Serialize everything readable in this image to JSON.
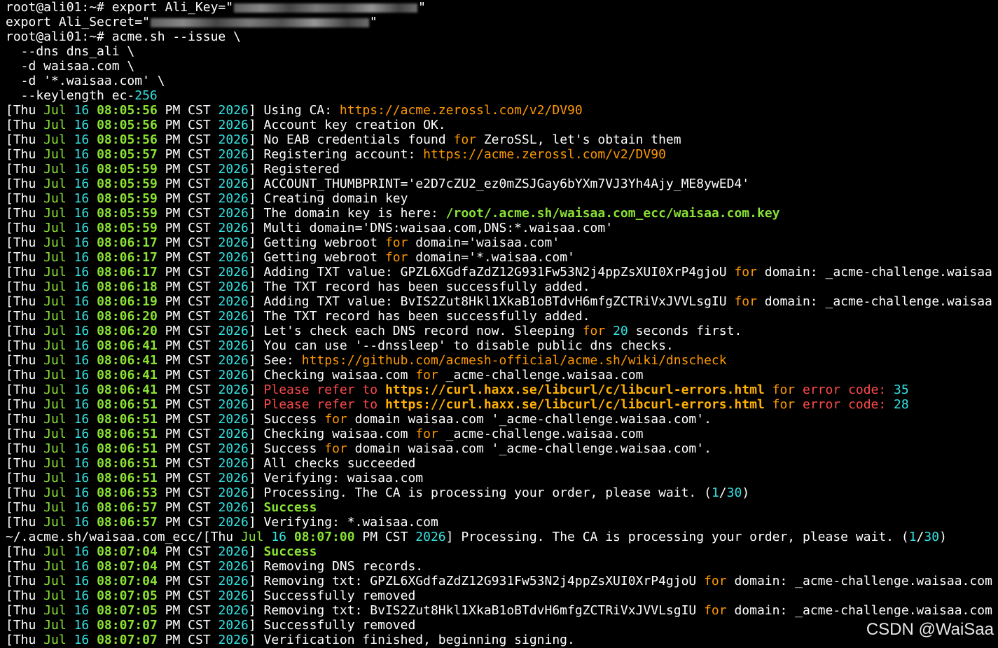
{
  "terminal": {
    "cmd1_prompt": "root@ali01:~# ",
    "cmd1_text": "export Ali_Key=\"",
    "cmd1_end": "\"",
    "cmd2_text": "export Ali_Secret=\"",
    "cmd2_end": "\"",
    "cmd3_prompt": "root@ali01:~# ",
    "cmd3_text": "acme.sh --issue \\",
    "cmd3_l2": "  --dns dns_ali \\",
    "cmd3_l3": "  -d waisaa.com \\",
    "cmd3_l4": "  -d '*.waisaa.com' \\",
    "cmd3_l5a": "  --keylength ec-",
    "cmd3_l5b": "256",
    "log": [
      {
        "time": "08:05:56",
        "parts": [
          {
            "t": "Using CA: "
          },
          {
            "t": "https://acme.zerossl.com/v2/DV90",
            "c": "o"
          }
        ]
      },
      {
        "time": "08:05:56",
        "parts": [
          {
            "t": "Account key creation OK."
          }
        ]
      },
      {
        "time": "08:05:56",
        "parts": [
          {
            "t": "No EAB credentials found "
          },
          {
            "t": "for",
            "c": "o"
          },
          {
            "t": " ZeroSSL, let's obtain them"
          }
        ]
      },
      {
        "time": "08:05:57",
        "parts": [
          {
            "t": "Registering account: "
          },
          {
            "t": "https://acme.zerossl.com/v2/DV90",
            "c": "o"
          }
        ]
      },
      {
        "time": "08:05:59",
        "parts": [
          {
            "t": "Registered"
          }
        ]
      },
      {
        "time": "08:05:59",
        "parts": [
          {
            "t": "ACCOUNT_THUMBPRINT='e2D7cZU2_ez0mZSJGay6bYXm7VJ3Yh4Ajy_ME8ywED4'"
          }
        ]
      },
      {
        "time": "08:05:59",
        "parts": [
          {
            "t": "Creating domain key"
          }
        ]
      },
      {
        "time": "08:05:59",
        "parts": [
          {
            "t": "The domain key is here: "
          },
          {
            "t": "/root/.acme.sh/waisaa.com_ecc/waisaa.com.key",
            "c": "gb"
          }
        ]
      },
      {
        "time": "08:05:59",
        "parts": [
          {
            "t": "Multi domain='DNS:waisaa.com,DNS:*.waisaa.com'"
          }
        ]
      },
      {
        "time": "08:06:17",
        "parts": [
          {
            "t": "Getting webroot "
          },
          {
            "t": "for",
            "c": "o"
          },
          {
            "t": " domain='waisaa.com'"
          }
        ]
      },
      {
        "time": "08:06:17",
        "parts": [
          {
            "t": "Getting webroot "
          },
          {
            "t": "for",
            "c": "o"
          },
          {
            "t": " domain='*.waisaa.com'"
          }
        ]
      },
      {
        "time": "08:06:17",
        "parts": [
          {
            "t": "Adding TXT value: GPZL6XGdfaZdZ12G931Fw53N2j4ppZsXUI0XrP4gjoU "
          },
          {
            "t": "for",
            "c": "o"
          },
          {
            "t": " domain: _acme-challenge.waisaa.com"
          }
        ]
      },
      {
        "time": "08:06:18",
        "parts": [
          {
            "t": "The TXT record has been successfully added."
          }
        ]
      },
      {
        "time": "08:06:19",
        "parts": [
          {
            "t": "Adding TXT value: BvIS2Zut8Hkl1XkaB1oBTdvH6mfgZCTRiVxJVVLsgIU "
          },
          {
            "t": "for",
            "c": "o"
          },
          {
            "t": " domain: _acme-challenge.waisaa.com"
          }
        ]
      },
      {
        "time": "08:06:20",
        "parts": [
          {
            "t": "The TXT record has been successfully added."
          }
        ]
      },
      {
        "time": "08:06:20",
        "parts": [
          {
            "t": "Let's check each DNS record now. Sleeping "
          },
          {
            "t": "for",
            "c": "o"
          },
          {
            "t": " "
          },
          {
            "t": "20",
            "c": "c"
          },
          {
            "t": " seconds first."
          }
        ]
      },
      {
        "time": "08:06:41",
        "parts": [
          {
            "t": "You can use '--dnssleep' to disable public dns checks."
          }
        ]
      },
      {
        "time": "08:06:41",
        "parts": [
          {
            "t": "See: "
          },
          {
            "t": "https://github.com/acmesh-official/acme.sh/wiki/dnscheck",
            "c": "o"
          }
        ]
      },
      {
        "time": "08:06:41",
        "parts": [
          {
            "t": "Checking waisaa.com "
          },
          {
            "t": "for",
            "c": "o"
          },
          {
            "t": " _acme-challenge.waisaa.com"
          }
        ]
      },
      {
        "time": "08:06:41",
        "parts": [
          {
            "t": "Please refer to ",
            "c": "r"
          },
          {
            "t": "https://curl.haxx.se/libcurl/c/libcurl-errors.html",
            "c": "ob"
          },
          {
            "t": " for",
            "c": "o"
          },
          {
            "t": " error code: ",
            "c": "r"
          },
          {
            "t": "35",
            "c": "c"
          }
        ]
      },
      {
        "time": "08:06:51",
        "parts": [
          {
            "t": "Please refer to ",
            "c": "r"
          },
          {
            "t": "https://curl.haxx.se/libcurl/c/libcurl-errors.html",
            "c": "ob"
          },
          {
            "t": " for",
            "c": "o"
          },
          {
            "t": " error code: ",
            "c": "r"
          },
          {
            "t": "28",
            "c": "c"
          }
        ]
      },
      {
        "time": "08:06:51",
        "parts": [
          {
            "t": "Success "
          },
          {
            "t": "for",
            "c": "o"
          },
          {
            "t": " domain waisaa.com '_acme-challenge.waisaa.com'."
          }
        ]
      },
      {
        "time": "08:06:51",
        "parts": [
          {
            "t": "Checking waisaa.com "
          },
          {
            "t": "for",
            "c": "o"
          },
          {
            "t": " _acme-challenge.waisaa.com"
          }
        ]
      },
      {
        "time": "08:06:51",
        "parts": [
          {
            "t": "Success "
          },
          {
            "t": "for",
            "c": "o"
          },
          {
            "t": " domain waisaa.com '_acme-challenge.waisaa.com'."
          }
        ]
      },
      {
        "time": "08:06:51",
        "parts": [
          {
            "t": "All checks succeeded"
          }
        ]
      },
      {
        "time": "08:06:51",
        "parts": [
          {
            "t": "Verifying: waisaa.com"
          }
        ]
      },
      {
        "time": "08:06:53",
        "parts": [
          {
            "t": "Processing. The CA is processing your order, please wait. ("
          },
          {
            "t": "1",
            "c": "c"
          },
          {
            "t": "/"
          },
          {
            "t": "30",
            "c": "c"
          },
          {
            "t": ")"
          }
        ]
      },
      {
        "time": "08:06:57",
        "parts": [
          {
            "t": "Success",
            "c": "gb"
          }
        ]
      },
      {
        "time": "08:06:57",
        "parts": [
          {
            "t": "Verifying: *.waisaa.com"
          }
        ]
      },
      {
        "prefix": "~/.acme.sh/waisaa.com_ecc/",
        "time": "08:07:00",
        "parts": [
          {
            "t": "Processing. The CA is processing your order, please wait. ("
          },
          {
            "t": "1",
            "c": "c"
          },
          {
            "t": "/"
          },
          {
            "t": "30",
            "c": "c"
          },
          {
            "t": ")"
          }
        ]
      },
      {
        "time": "08:07:04",
        "parts": [
          {
            "t": "Success",
            "c": "gb"
          }
        ]
      },
      {
        "time": "08:07:04",
        "parts": [
          {
            "t": "Removing DNS records."
          }
        ]
      },
      {
        "time": "08:07:04",
        "parts": [
          {
            "t": "Removing txt: GPZL6XGdfaZdZ12G931Fw53N2j4ppZsXUI0XrP4gjoU "
          },
          {
            "t": "for",
            "c": "o"
          },
          {
            "t": " domain: _acme-challenge.waisaa.com"
          }
        ]
      },
      {
        "time": "08:07:05",
        "parts": [
          {
            "t": "Successfully removed"
          }
        ]
      },
      {
        "time": "08:07:05",
        "parts": [
          {
            "t": "Removing txt: BvIS2Zut8Hkl1XkaB1oBTdvH6mfgZCTRiVxJVVLsgIU "
          },
          {
            "t": "for",
            "c": "o"
          },
          {
            "t": " domain: _acme-challenge.waisaa.com"
          }
        ]
      },
      {
        "time": "08:07:07",
        "parts": [
          {
            "t": "Successfully removed"
          }
        ]
      },
      {
        "time": "08:07:07",
        "parts": [
          {
            "t": "Verification finished, beginning signing."
          }
        ]
      }
    ],
    "ts_open": "[",
    "ts_day": "Thu ",
    "ts_month": "Jul",
    "ts_date": "16",
    "ts_ampm": " PM CST ",
    "ts_year": "2026",
    "ts_close": "] "
  },
  "watermark": "CSDN @WaiSaa",
  "colors": {
    "background": "#000000",
    "text": "#ffffff",
    "green": "#8ae234",
    "cyan": "#34e2e2",
    "orange": "#ff9900",
    "red": "#ff4a4a",
    "url_bold": "#ffb000"
  }
}
